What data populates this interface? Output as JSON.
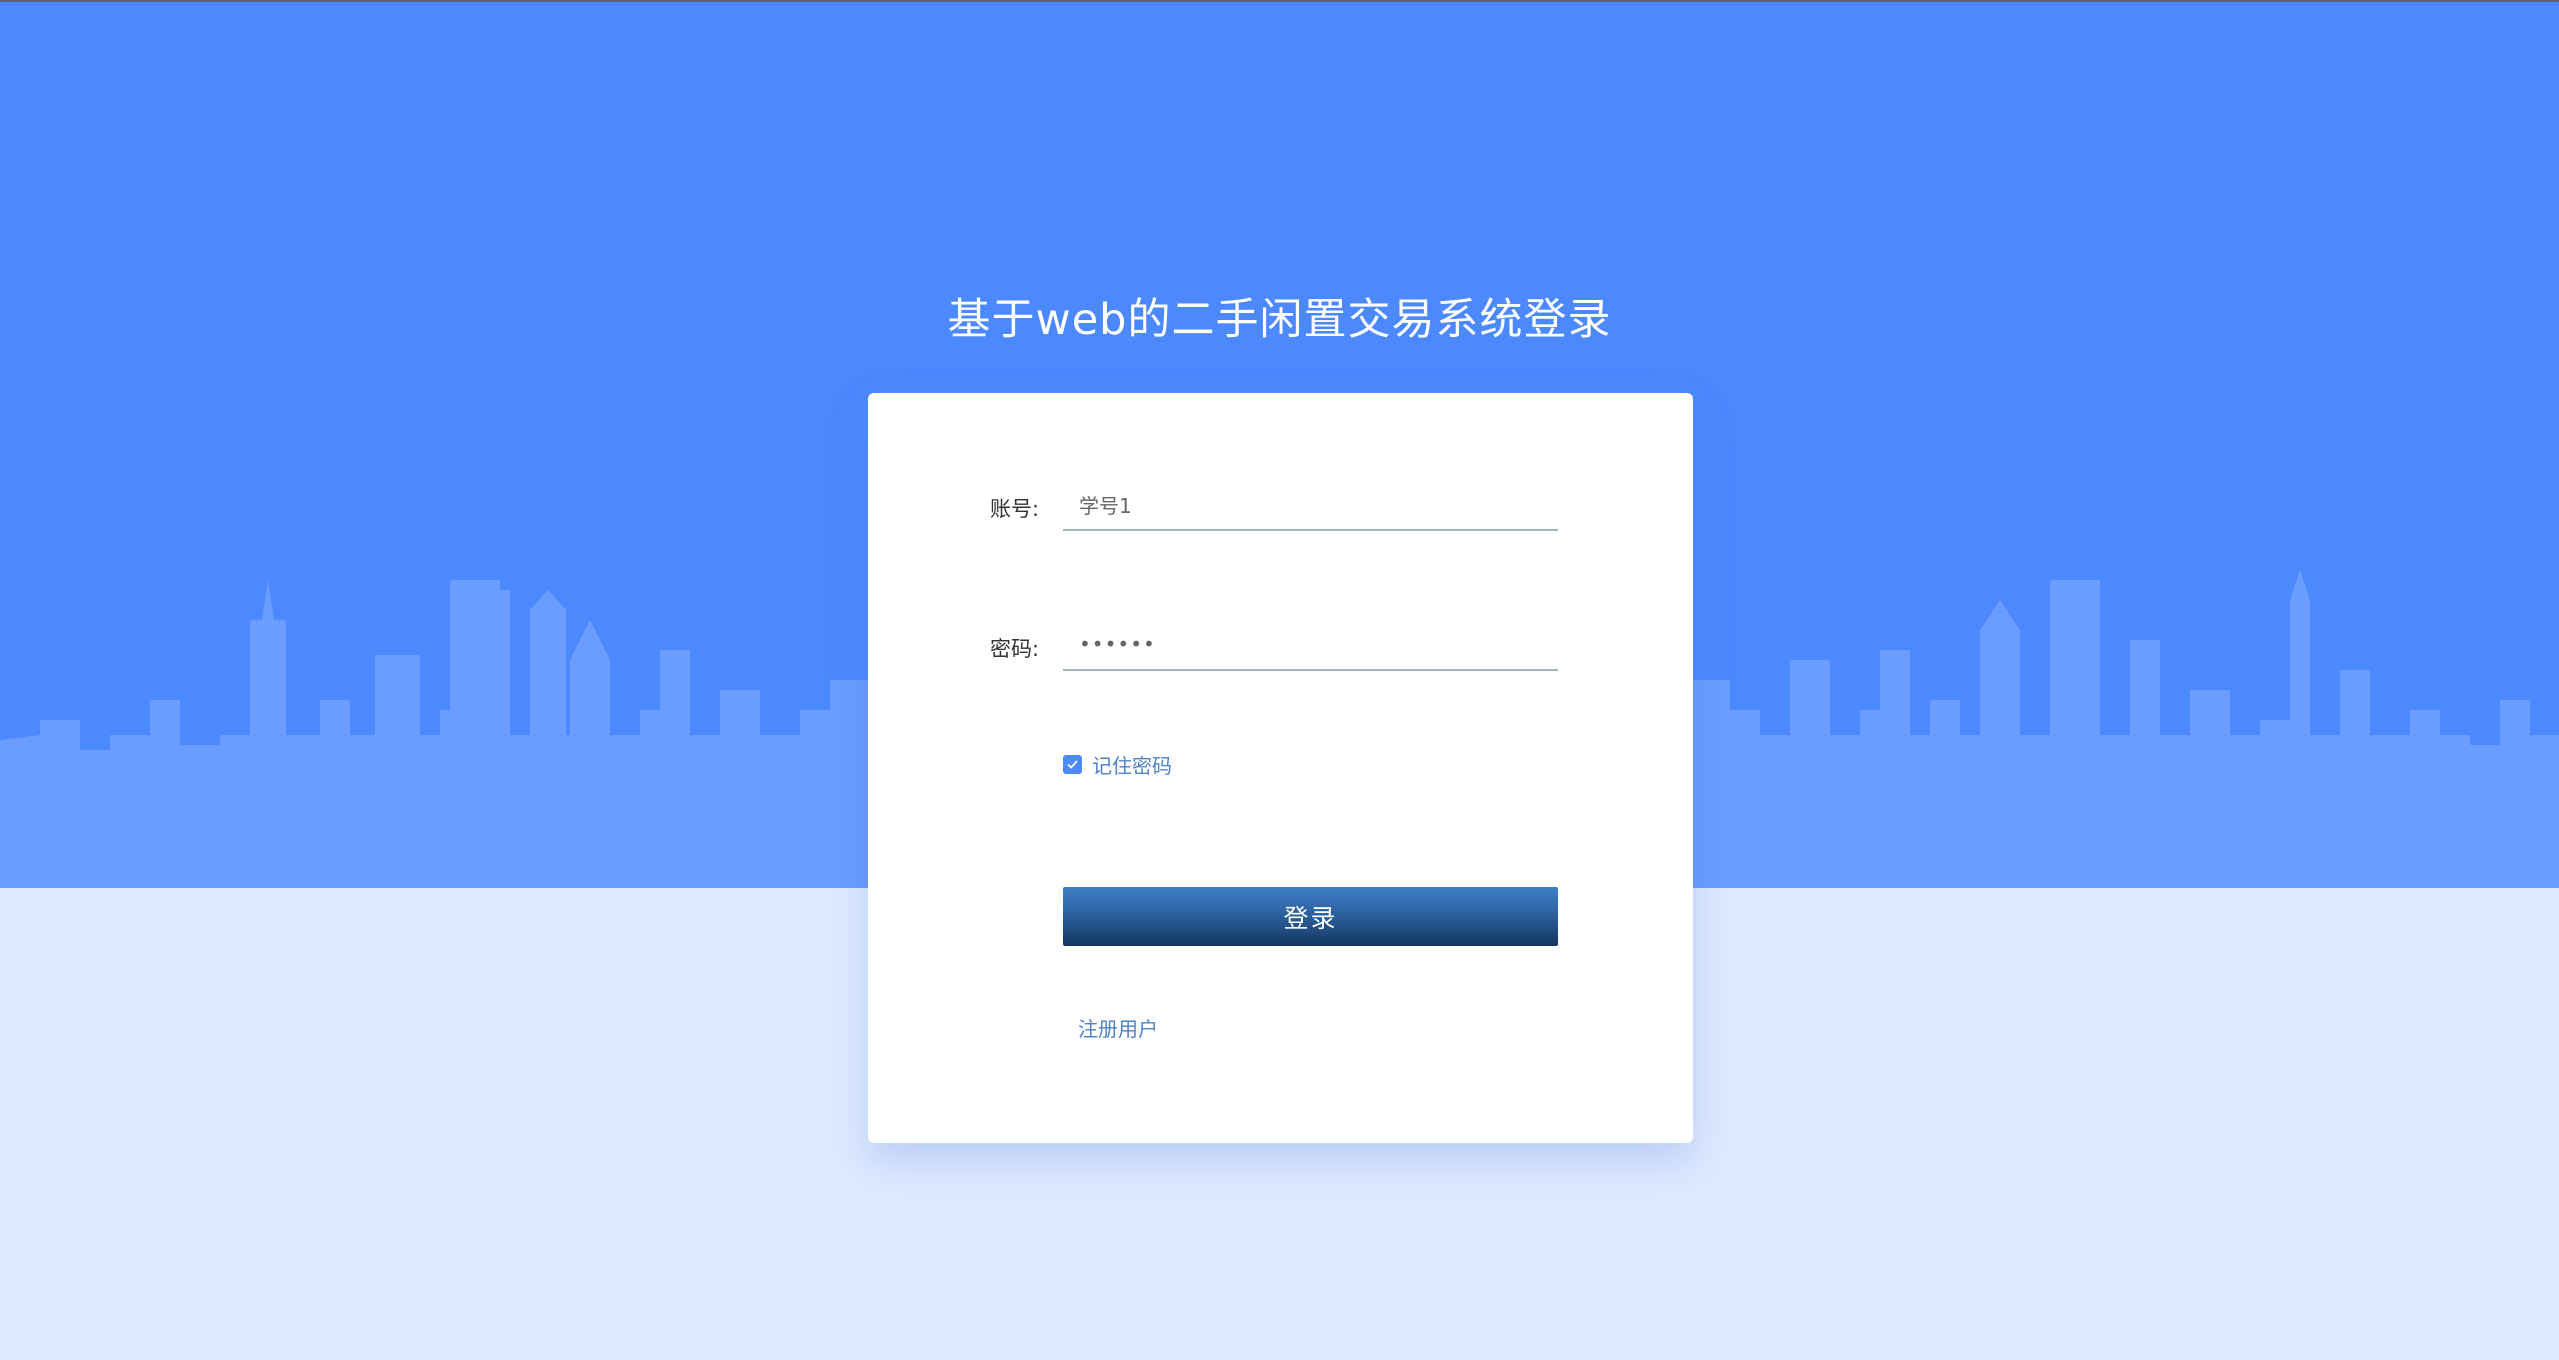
{
  "page": {
    "title": "基于web的二手闲置交易系统登录"
  },
  "login_form": {
    "account": {
      "label": "账号:",
      "value": "学号1"
    },
    "password": {
      "label": "密码:",
      "value": "••••••"
    },
    "remember": {
      "label": "记住密码",
      "checked": true
    },
    "submit_label": "登录",
    "register_label": "注册用户"
  },
  "colors": {
    "sky": "#4c89ff",
    "skyline": "#6a9dff",
    "ground": "#dfeaff",
    "button_top": "#3f7fc6",
    "button_bottom": "#15375f",
    "link": "#4f80c8"
  }
}
